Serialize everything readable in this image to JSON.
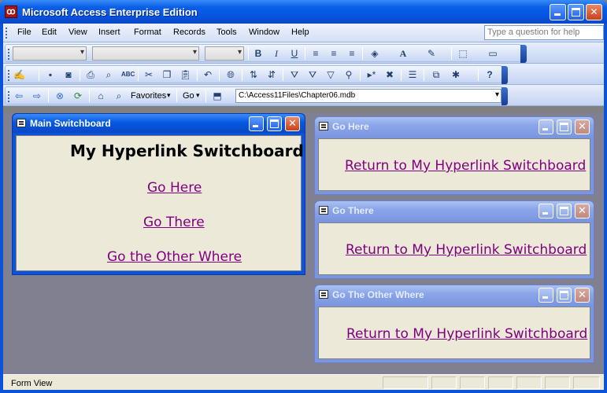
{
  "window": {
    "title": "Microsoft Access Enterprise Edition",
    "icon": "access-key-icon"
  },
  "menu": {
    "items": [
      "File",
      "Edit",
      "View",
      "Insert",
      "Format",
      "Records",
      "Tools",
      "Window",
      "Help"
    ],
    "help_placeholder": "Type a question for help"
  },
  "web_toolbar": {
    "favorites_label": "Favorites",
    "go_label": "Go",
    "address": "C:\\Access11Files\\Chapter06.mdb"
  },
  "forms": {
    "main": {
      "title": "Main Switchboard",
      "heading": "My Hyperlink Switchboard",
      "links": [
        "Go Here",
        "Go There",
        "Go the Other Where"
      ]
    },
    "go_here": {
      "title": "Go Here",
      "link": "Return to My Hyperlink Switchboard"
    },
    "go_there": {
      "title": "Go There",
      "link": "Return to My Hyperlink Switchboard"
    },
    "go_other": {
      "title": "Go The Other Where",
      "link": "Return to My Hyperlink Switchboard"
    }
  },
  "status": {
    "text": "Form View"
  },
  "colors": {
    "title_active": "#0554e0",
    "hyperlink": "#800080",
    "form_bg": "#ece9d8",
    "mdi_bg": "#808090"
  }
}
